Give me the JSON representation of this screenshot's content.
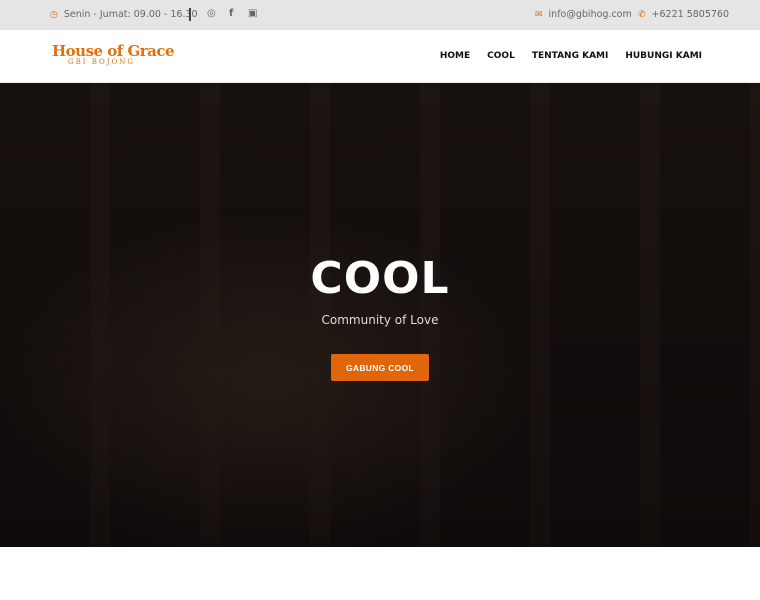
{
  "topbar": {
    "hours": "Senin - Jumat: 09.00 - 16.30",
    "email": "info@gbihog.com",
    "phone": "+6221 5805760",
    "icons": [
      "clock-icon",
      "instagram-icon",
      "facebook-icon",
      "youtube-icon",
      "envelope-icon",
      "phone-icon"
    ]
  },
  "logo": {
    "main": "House of Grace",
    "sub": "GBI BOJONG"
  },
  "nav": {
    "items": [
      "HOME",
      "COOL",
      "TENTANG KAMI",
      "HUBUNGI KAMI"
    ]
  },
  "hero": {
    "title": "COOL",
    "subtitle": "Community of Love",
    "button": "GABUNG COOL"
  },
  "colors": {
    "accent": "#e0650b"
  }
}
